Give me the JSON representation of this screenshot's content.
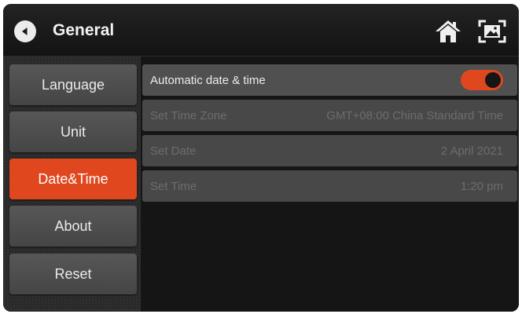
{
  "header": {
    "title": "General"
  },
  "sidebar": {
    "items": [
      {
        "label": "Language"
      },
      {
        "label": "Unit"
      },
      {
        "label": "Date&Time",
        "active": true
      },
      {
        "label": "About"
      },
      {
        "label": "Reset"
      }
    ]
  },
  "settings": {
    "automatic": {
      "label": "Automatic date & time",
      "enabled": true
    },
    "time_zone": {
      "label": "Set Time Zone",
      "value": "GMT+08:00 China Standard Time"
    },
    "date": {
      "label": "Set Date",
      "value": "2 April 2021"
    },
    "time": {
      "label": "Set Time",
      "value": "1:20 pm"
    }
  },
  "icons": {
    "back": "back-arrow-icon",
    "home": "home-icon",
    "screenshot": "screenshot-icon"
  },
  "colors": {
    "accent": "#e0471f",
    "background": "#151515",
    "row": "#4d4d4d"
  }
}
